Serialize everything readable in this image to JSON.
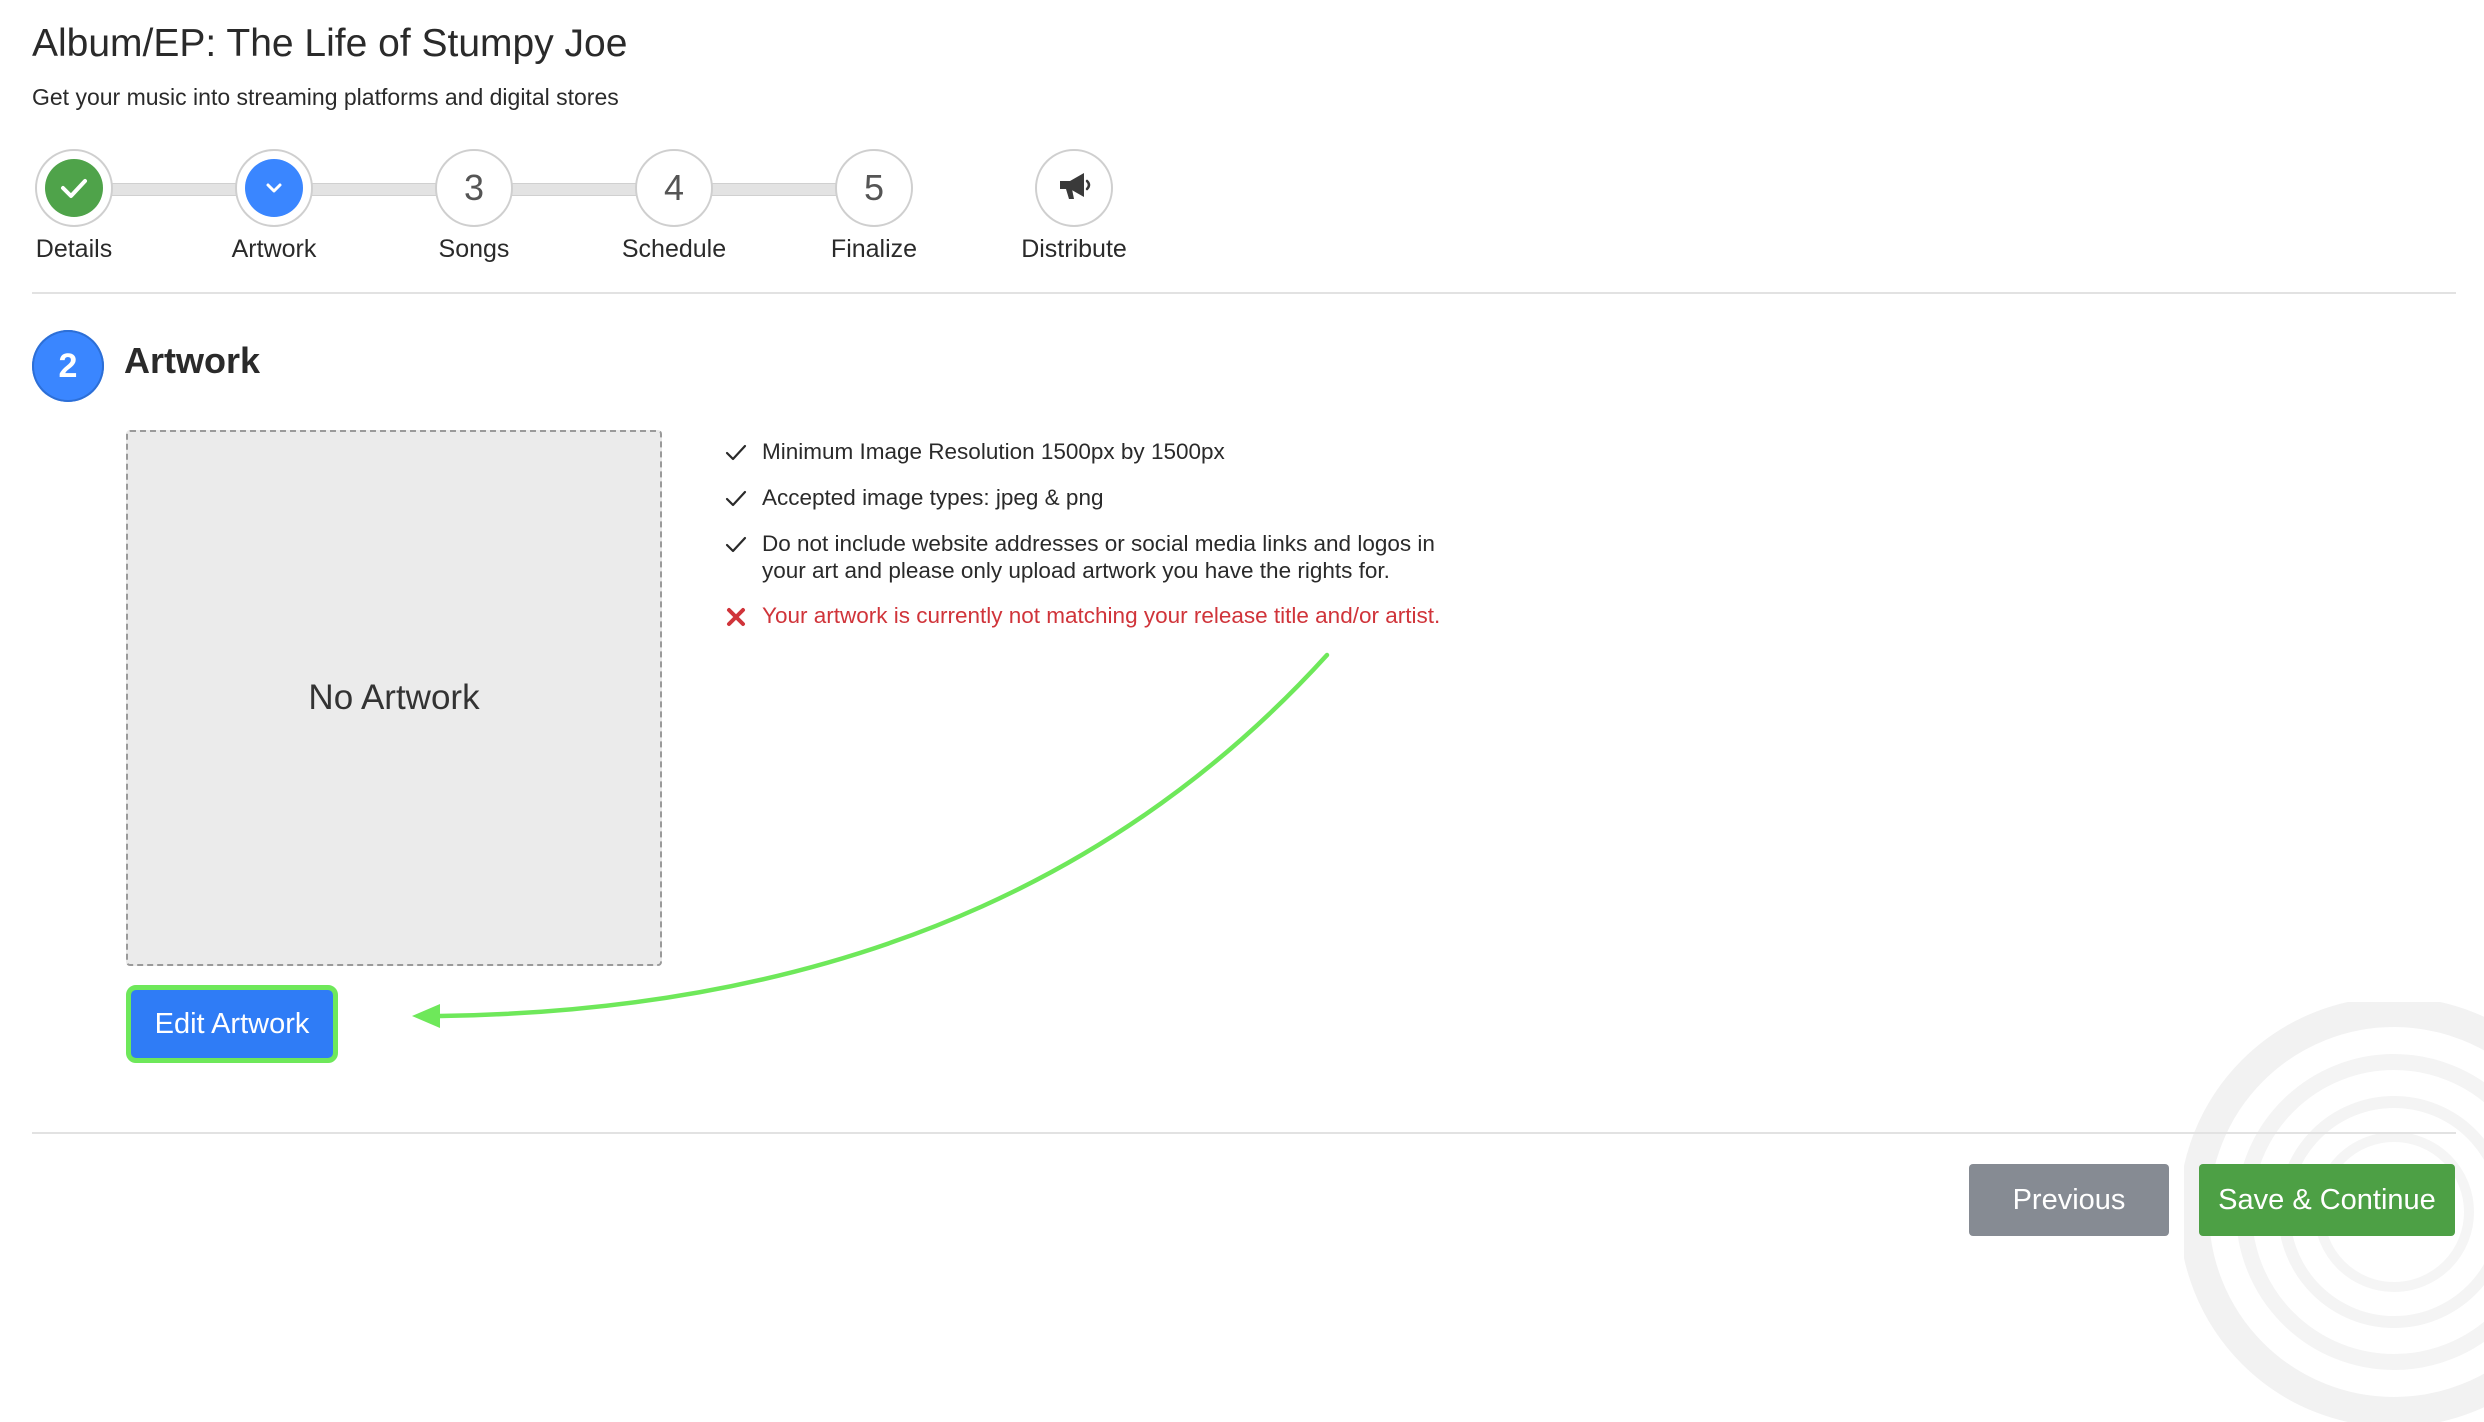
{
  "header": {
    "title": "Album/EP: The Life of Stumpy Joe",
    "subtitle": "Get your music into streaming platforms and digital stores"
  },
  "stepper": {
    "steps": [
      {
        "label": "Details",
        "state": "complete",
        "icon": "check-icon"
      },
      {
        "label": "Artwork",
        "state": "active",
        "icon": "chevron-down-icon"
      },
      {
        "label": "Songs",
        "state": "pending",
        "number": "3"
      },
      {
        "label": "Schedule",
        "state": "pending",
        "number": "4"
      },
      {
        "label": "Finalize",
        "state": "pending",
        "number": "5"
      },
      {
        "label": "Distribute",
        "state": "pending",
        "icon": "megaphone-icon"
      }
    ]
  },
  "section": {
    "number": "2",
    "title": "Artwork"
  },
  "artwork": {
    "placeholder": "No Artwork",
    "edit_button": "Edit Artwork"
  },
  "requirements": [
    {
      "text": "Minimum Image Resolution 1500px by 1500px",
      "status": "ok",
      "icon": "check-icon"
    },
    {
      "text": "Accepted image types: jpeg & png",
      "status": "ok",
      "icon": "check-icon"
    },
    {
      "text": "Do not include website addresses or social media links and logos in your art and please only upload artwork you have the rights for.",
      "status": "ok",
      "icon": "check-icon"
    },
    {
      "text": "Your artwork is currently not matching your release title and/or artist.",
      "status": "error",
      "icon": "x-icon"
    }
  ],
  "footer": {
    "previous": "Previous",
    "save_continue": "Save & Continue"
  },
  "colors": {
    "complete": "#4fa34a",
    "active": "#3a86ff",
    "error": "#d0343a",
    "annotation_arrow": "#6ee85a",
    "save": "#4da045",
    "previous": "#868b93"
  }
}
